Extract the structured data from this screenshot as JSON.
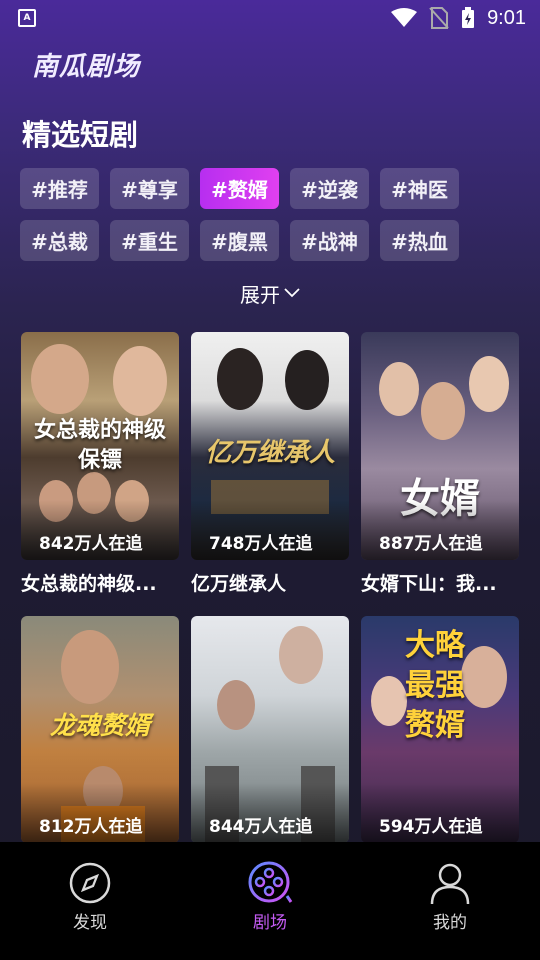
{
  "status_bar": {
    "app_icon_letter": "A",
    "time": "9:01",
    "icons": [
      "wifi-icon",
      "no-sim-icon",
      "battery-charging-icon"
    ]
  },
  "app": {
    "title": "南瓜剧场"
  },
  "section": {
    "title": "精选短剧"
  },
  "tags": [
    {
      "label": "#推荐",
      "active": false
    },
    {
      "label": "#尊享",
      "active": false
    },
    {
      "label": "#赘婿",
      "active": true
    },
    {
      "label": "#逆袭",
      "active": false
    },
    {
      "label": "#神医",
      "active": false
    },
    {
      "label": "#总裁",
      "active": false
    },
    {
      "label": "#重生",
      "active": false
    },
    {
      "label": "#腹黑",
      "active": false
    },
    {
      "label": "#战神",
      "active": false
    },
    {
      "label": "#热血",
      "active": false
    }
  ],
  "expand": {
    "label": "展开",
    "icon": "chevron-down-icon"
  },
  "dramas": [
    {
      "title": "女总裁的神级...",
      "viewers": "842万人在追",
      "poster_text": "女总裁的神级保镖"
    },
    {
      "title": "亿万继承人",
      "viewers": "748万人在追",
      "poster_text": "亿万继承人"
    },
    {
      "title": "女婿下山：我...",
      "viewers": "887万人在追",
      "poster_text": "女婿"
    },
    {
      "title": "",
      "viewers": "812万人在追",
      "poster_text": "龙魂赘婿"
    },
    {
      "title": "",
      "viewers": "844万人在追",
      "poster_text": ""
    },
    {
      "title": "",
      "viewers": "594万人在追",
      "poster_text": "大略最强赘婿"
    }
  ],
  "nav": [
    {
      "label": "发现",
      "icon": "compass-icon",
      "active": false
    },
    {
      "label": "剧场",
      "icon": "film-reel-icon",
      "active": true
    },
    {
      "label": "我的",
      "icon": "user-icon",
      "active": false
    }
  ],
  "colors": {
    "accent": "#c65cf5",
    "tag_active": "#d23ff0"
  }
}
